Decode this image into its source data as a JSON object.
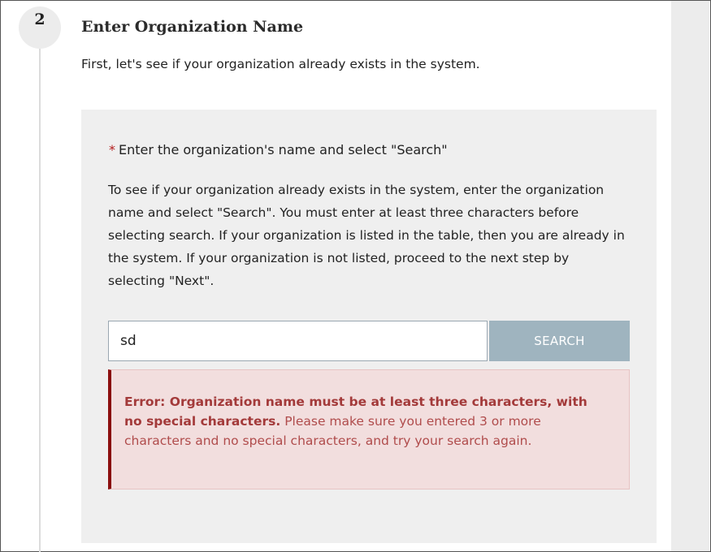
{
  "step": {
    "number": "2",
    "title": "Enter Organization Name",
    "description": "First, let's see if your organization already exists in the system."
  },
  "search": {
    "required_marker": "*",
    "label": "Enter the organization's name and select \"Search\"",
    "help": "To see if your organization already exists in the system, enter the organization name and select \"Search\". You must enter at least three characters before selecting search. If your organization is listed in the table, then you are already in the system. If your organization is not listed, proceed to the next step by selecting \"Next\".",
    "input_value": "sd",
    "button_label": "SEARCH"
  },
  "error": {
    "strong": "Error: Organization name must be at least three characters, with no special characters.",
    "message": "Please make sure you entered 3 or more characters and no special characters, and try your search again."
  },
  "colors": {
    "error_text": "#b04c4c",
    "error_bg": "#f2dede",
    "error_border": "#8b0d0d",
    "button_bg": "#9fb4bf",
    "required": "#b31b1b"
  }
}
